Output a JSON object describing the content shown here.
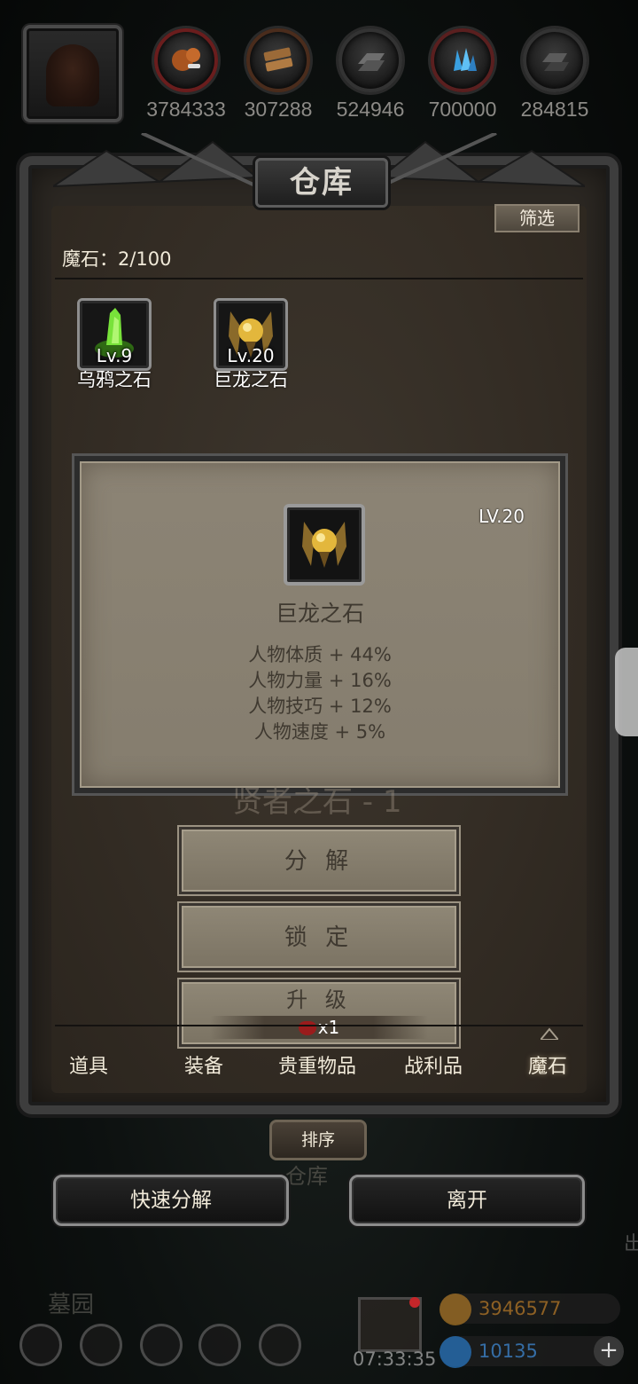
{
  "resources": [
    {
      "icon": "meat-icon",
      "value": "3784333",
      "color": "#b5602a"
    },
    {
      "icon": "wood-icon",
      "value": "307288",
      "color": "#9a6b3a"
    },
    {
      "icon": "iron-ingot-icon",
      "value": "524946",
      "color": "#6a6a6a"
    },
    {
      "icon": "crystal-icon",
      "value": "700000",
      "color": "#3a9ad8"
    },
    {
      "icon": "stone-ingot-icon",
      "value": "284815",
      "color": "#555555"
    }
  ],
  "panel": {
    "title": "仓库",
    "filter_label": "筛选",
    "count_label": "魔石：2/100"
  },
  "items": [
    {
      "name": "乌鸦之石",
      "level": "Lv.9",
      "icon": "crow-stone-icon",
      "color": "#5fd12a"
    },
    {
      "name": "巨龙之石",
      "level": "Lv.20",
      "icon": "dragon-stone-icon",
      "color": "#c99a2a"
    }
  ],
  "detail": {
    "level": "LV.20",
    "name": "巨龙之石",
    "stats": [
      "人物体质 + 44%",
      "人物力量 + 16%",
      "人物技巧 + 12%",
      "人物速度 + 5%"
    ],
    "ghost_text": "贤者之石 - 1"
  },
  "actions": {
    "decompose": "分 解",
    "lock": "锁 定",
    "upgrade": "升 级",
    "upgrade_cost": "x1"
  },
  "tabs": [
    "道具",
    "装备",
    "贵重物品",
    "战利品",
    "魔石"
  ],
  "active_tab": "魔石",
  "bottom": {
    "sort_label": "排序",
    "faded_label": "仓库",
    "quick_decompose": "快速分解",
    "leave": "离开"
  },
  "hud": {
    "area_name": "墓园",
    "clock": "07:33:35",
    "gold": "3946577",
    "gems": "10135",
    "side_text": "出",
    "gold_color": "#c98a2a",
    "gem_color": "#2a7ac9"
  }
}
